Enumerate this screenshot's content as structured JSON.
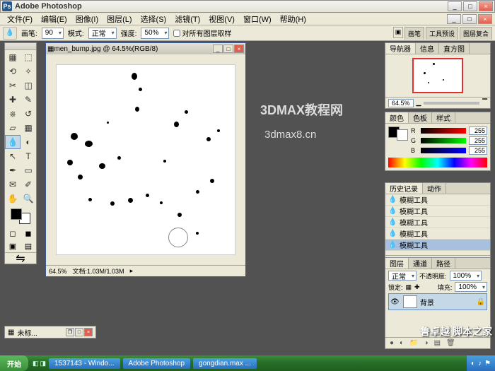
{
  "app": {
    "title": "Adobe Photoshop"
  },
  "menu": [
    "文件(F)",
    "编辑(E)",
    "图像(I)",
    "图层(L)",
    "选择(S)",
    "滤镜(T)",
    "视图(V)",
    "窗口(W)",
    "帮助(H)"
  ],
  "menu_right_btns": [
    "_",
    "□",
    "×"
  ],
  "options": {
    "brush_label": "画笔:",
    "brush_size": "90",
    "mode_label": "模式:",
    "mode_value": "正常",
    "strength_label": "强度:",
    "strength_value": "50%",
    "sample_all": "对所有图层取样",
    "right_tabs": [
      "画笔",
      "工具预设",
      "图层复合"
    ]
  },
  "doc": {
    "title": "men_bump.jpg @ 64.5%(RGB/8)",
    "zoom": "64.5%",
    "filesize": "文档:1.03M/1.03M"
  },
  "watermark": {
    "line1": "3DMAX教程网",
    "line2": "3dmax8.cn"
  },
  "navigator": {
    "tabs": [
      "导航器",
      "信息",
      "直方图"
    ],
    "zoom": "64.5%"
  },
  "color": {
    "tabs": [
      "颜色",
      "色板",
      "样式"
    ],
    "r": "255",
    "g": "255",
    "b": "255",
    "r_label": "R",
    "g_label": "G",
    "b_label": "B"
  },
  "history": {
    "tabs": [
      "历史记录",
      "动作"
    ],
    "items": [
      "模糊工具",
      "模糊工具",
      "模糊工具",
      "模糊工具",
      "模糊工具"
    ]
  },
  "layers": {
    "tabs": [
      "图层",
      "通道",
      "路径"
    ],
    "mode": "正常",
    "opacity_label": "不透明度:",
    "opacity": "100%",
    "lock_label": "锁定:",
    "fill_label": "填充:",
    "fill": "100%",
    "layer_name": "背景"
  },
  "untitled_doc": "未标...",
  "br_mark": "鲁卓越 脚本之家",
  "taskbar": {
    "start": "开始",
    "items": [
      "1537143 - Windo...",
      "Adobe Photoshop",
      "gongdian.max ..."
    ],
    "time": ""
  }
}
